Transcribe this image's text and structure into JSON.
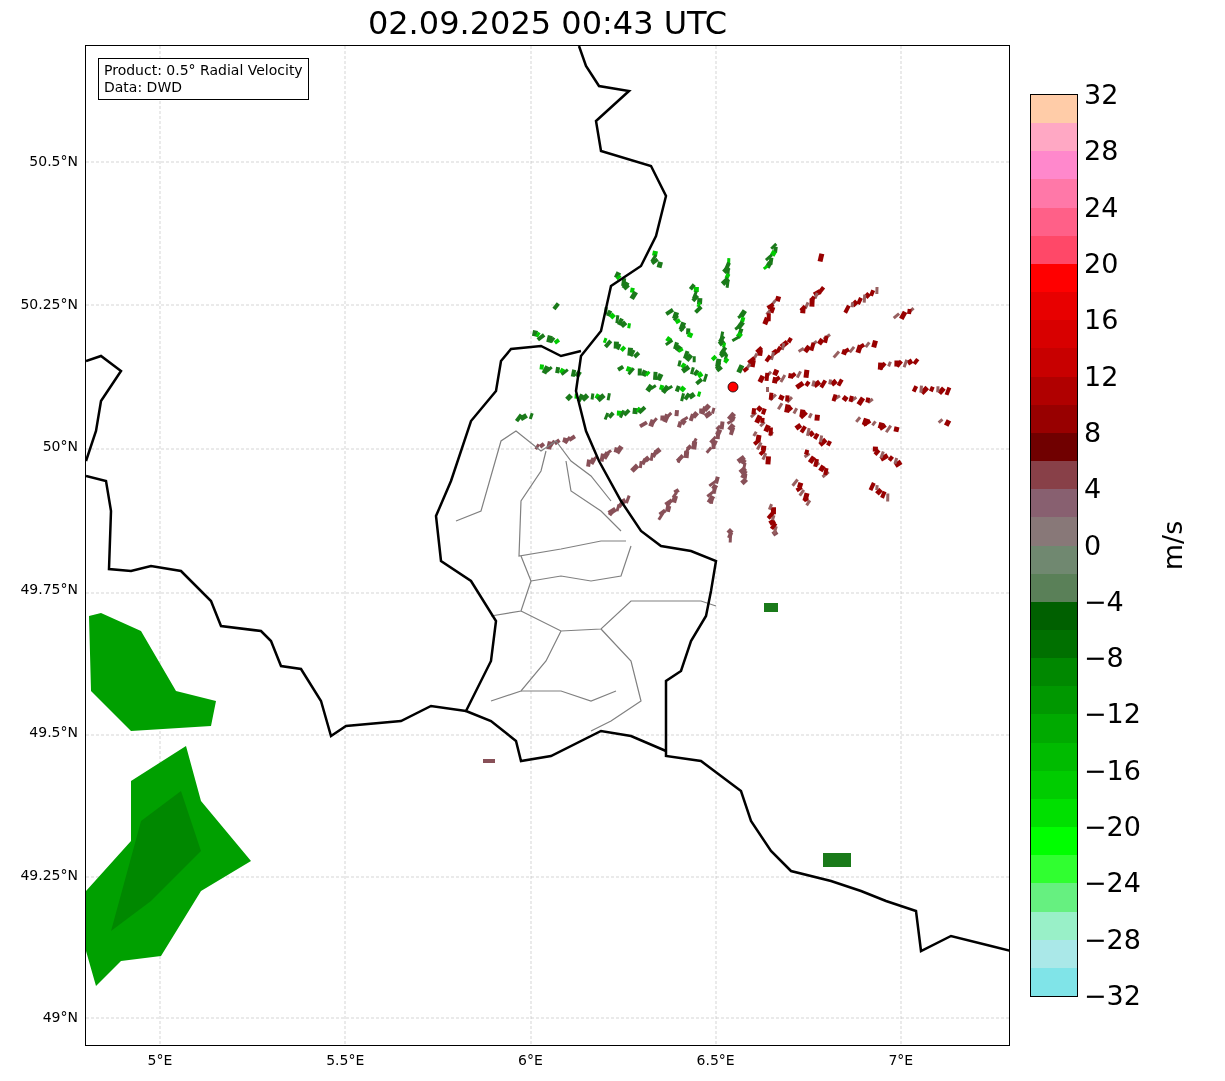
{
  "title": "02.09.2025 00:43 UTC",
  "info_box": [
    "Product: 0.5° Radial Velocity",
    "Data: DWD"
  ],
  "lat_labels": [
    "50.5°N",
    "50.25°N",
    "50°N",
    "49.75°N",
    "49.5°N",
    "49.25°N",
    "49°N"
  ],
  "lon_labels": [
    "5°E",
    "5.5°E",
    "6°E",
    "6.5°E",
    "7°E"
  ],
  "colorbar": {
    "label": "m/s",
    "ticks": [
      "32",
      "28",
      "24",
      "20",
      "16",
      "12",
      "8",
      "4",
      "0",
      "−4",
      "−8",
      "−12",
      "−16",
      "−20",
      "−24",
      "−28",
      "−32"
    ],
    "bins": [
      {
        "color": "#ffcca8"
      },
      {
        "color": "#ffa8c4"
      },
      {
        "color": "#ff88cc"
      },
      {
        "color": "#ff78a8"
      },
      {
        "color": "#ff6088"
      },
      {
        "color": "#ff4868"
      },
      {
        "color": "#ff0000"
      },
      {
        "color": "#e80000"
      },
      {
        "color": "#d80000"
      },
      {
        "color": "#c80000"
      },
      {
        "color": "#b00000"
      },
      {
        "color": "#980000"
      },
      {
        "color": "#700000"
      },
      {
        "color": "#884048"
      },
      {
        "color": "#886070"
      },
      {
        "color": "#887878"
      },
      {
        "color": "#708870"
      },
      {
        "color": "#5a8058"
      },
      {
        "color": "#006000"
      },
      {
        "color": "#007000"
      },
      {
        "color": "#008800"
      },
      {
        "color": "#009800"
      },
      {
        "color": "#00aa00"
      },
      {
        "color": "#00bb00"
      },
      {
        "color": "#00cc00"
      },
      {
        "color": "#00e000"
      },
      {
        "color": "#00ff00"
      },
      {
        "color": "#30ff30"
      },
      {
        "color": "#66f080"
      },
      {
        "color": "#99f0c8"
      },
      {
        "color": "#aae8e8"
      },
      {
        "color": "#80e4e8"
      }
    ]
  }
}
